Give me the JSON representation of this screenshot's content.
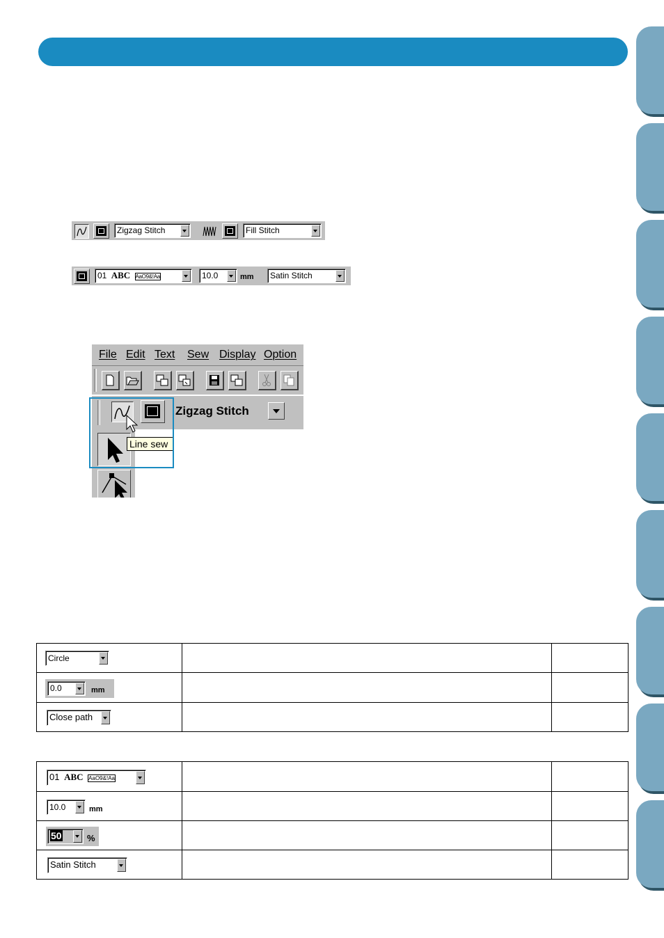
{
  "colors": {
    "accent": "#1a8bc1",
    "side_tab": "#7aa8c1",
    "side_tab_shadow": "#2f5566",
    "panel_gray": "#c0c0c0"
  },
  "header": {
    "title": ""
  },
  "toolbar1": {
    "line_sew_icon": "line-sew-icon",
    "zigzag_select": "Zigzag Stitch",
    "fill_sew_icon": "fill-sew-icon",
    "fill_select": "Fill Stitch"
  },
  "toolbar2": {
    "font_prefix": "01",
    "font_sample": "ABC",
    "font_glyphs": "AaO9&!Aa",
    "size_value": "10.0",
    "size_unit": "mm",
    "stitch_select": "Satin Stitch"
  },
  "screenshot": {
    "menu": [
      "File",
      "Edit",
      "Text",
      "Sew",
      "Display",
      "Option"
    ],
    "zigzag_select": "Zigzag Stitch",
    "tooltip": "Line sew"
  },
  "table1": {
    "rows": [
      {
        "control": "Circle",
        "type": "select"
      },
      {
        "control": "0.0",
        "unit": "mm",
        "type": "spinner"
      },
      {
        "control": "Close path",
        "type": "select"
      }
    ]
  },
  "table2": {
    "rows": [
      {
        "control_prefix": "01",
        "control_sample": "ABC",
        "control_glyphs": "AaO9&!Aa",
        "type": "font"
      },
      {
        "control": "10.0",
        "unit": "mm",
        "type": "spinner"
      },
      {
        "control": "50",
        "unit": "%",
        "type": "spinner-dark"
      },
      {
        "control": "Satin Stitch",
        "type": "select"
      }
    ]
  }
}
